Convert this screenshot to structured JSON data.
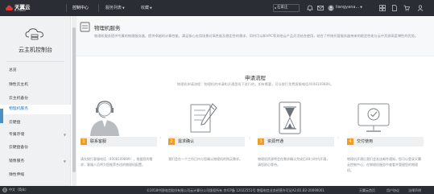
{
  "topbar": {
    "brand_name": "天翼云",
    "brand_sub": "e Cloud",
    "nav": [
      {
        "label": "控制中心"
      },
      {
        "label": "服务列表"
      },
      {
        "label": "收藏"
      }
    ],
    "region": "石家庄",
    "username": "liangyana..."
  },
  "sidebar": {
    "title": "云主机控制台",
    "items": [
      {
        "label": "总览"
      },
      {
        "label": "弹性云主机"
      },
      {
        "label": "云主机备份"
      },
      {
        "label": "物理机服务"
      },
      {
        "label": "云硬盘"
      },
      {
        "label": "专属存储"
      },
      {
        "label": "云硬盘备份"
      },
      {
        "label": "镜像服务"
      },
      {
        "label": "弹性伸缩"
      }
    ],
    "active_index": 3
  },
  "service": {
    "title": "物理机服务",
    "description": "物理机服务提供专属的物理服务器，提供卓越的计算性能，满足核心应用场景对高性能及稳定性的需求，同时可以和VPC等其他云产品灵活结合使用，结合了传统托管服务器带来的稳定性能与云中资源高度弹性的优势。"
  },
  "flow": {
    "title": "申请流程",
    "subtitle": "物理机申请流程：物理机的申请和开通是线下进行的，如有需要，可以拨打免费客服电话4008109889。",
    "steps": [
      {
        "num": "1",
        "label": "联系客服",
        "desc": "请先拨打客服电话（4008109889），根据您的需求，客服人员将为您推荐合适的物理机配置。"
      },
      {
        "num": "2",
        "label": "需求确认",
        "desc": "我们会在一个工作日内与您确认物理机的购买需求。"
      },
      {
        "num": "3",
        "label": "资源开通",
        "desc": "物理机资源将会在需求确认完成后48小时内开通，请您耐心等待。"
      },
      {
        "num": "4",
        "label": "交付使用",
        "desc": "物理机开通后我们会发送邮件通知，您可以登录天翼云控制中心，在物理机服务中查看并管理您的物理机。"
      }
    ]
  },
  "footer": {
    "language": "中文（简体）",
    "copyright": "©2018中国电信股份有限公司云计算分公司版权所有  京ICP备 12022551号  增值电信业务经营许可证A2.B1.B2-20090001",
    "links": [
      {
        "label": "天翼云首页"
      },
      {
        "label": "用户协议"
      },
      {
        "label": "法律声明"
      }
    ]
  },
  "colors": {
    "topbar_bg": "#2a2d33",
    "accent_blue": "#2a78c8",
    "step_orange": "#f29c1f"
  }
}
